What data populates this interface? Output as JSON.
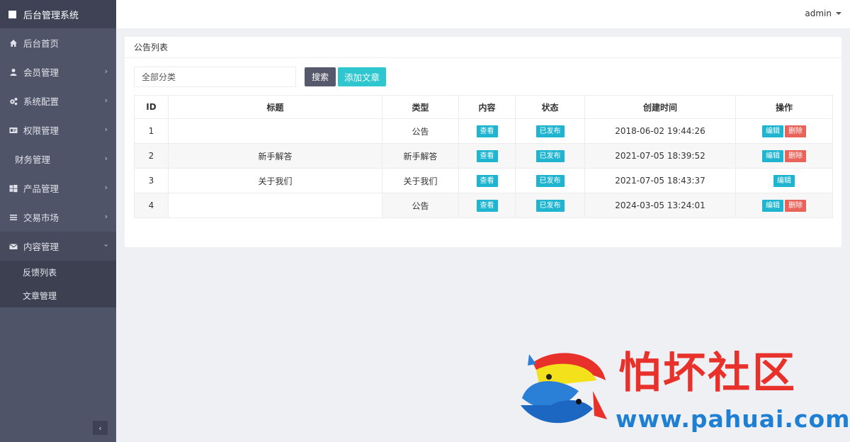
{
  "app": {
    "brand": "后台管理系统"
  },
  "sidebar": {
    "items": [
      {
        "label": "后台首页",
        "icon": "home-icon"
      },
      {
        "label": "会员管理",
        "icon": "user-icon"
      },
      {
        "label": "系统配置",
        "icon": "gears-icon"
      },
      {
        "label": "权限管理",
        "icon": "card-icon"
      },
      {
        "label": "财务管理",
        "icon": ""
      },
      {
        "label": "产品管理",
        "icon": "windows-icon"
      },
      {
        "label": "交易市场",
        "icon": "menu-icon"
      },
      {
        "label": "内容管理",
        "icon": "envelope-icon"
      }
    ],
    "submenu": [
      "反馈列表",
      "文章管理"
    ],
    "collapse_glyph": "‹"
  },
  "topbar": {
    "user": "admin"
  },
  "panel": {
    "title": "公告列表",
    "filter_value": "全部分类",
    "search_label": "搜索",
    "add_label": "添加文章"
  },
  "table": {
    "headers": [
      "ID",
      "标题",
      "类型",
      "内容",
      "状态",
      "创建时间",
      "操作"
    ],
    "view_label": "查看",
    "status_label": "已发布",
    "edit_label": "编辑",
    "delete_label": "删除",
    "rows": [
      {
        "id": "1",
        "title": "",
        "type": "公告",
        "created": "2018-06-02 19:44:26",
        "can_delete": true
      },
      {
        "id": "2",
        "title": "新手解答",
        "type": "新手解答",
        "created": "2021-07-05 18:39:52",
        "can_delete": true
      },
      {
        "id": "3",
        "title": "关于我们",
        "type": "关于我们",
        "created": "2021-07-05 18:43:37",
        "can_delete": false
      },
      {
        "id": "4",
        "title": "",
        "type": "公告",
        "created": "2024-03-05 13:24:01",
        "can_delete": true
      }
    ]
  },
  "watermark": {
    "name": "怕坏社区",
    "url": "www.pahuai.com"
  },
  "colors": {
    "sidebar": "#505469",
    "accent": "#2ec6cf",
    "tag": "#1fb5d0",
    "danger": "#e9635a",
    "watermark_red": "#e8312b",
    "watermark_blue": "#1f7fd3"
  }
}
